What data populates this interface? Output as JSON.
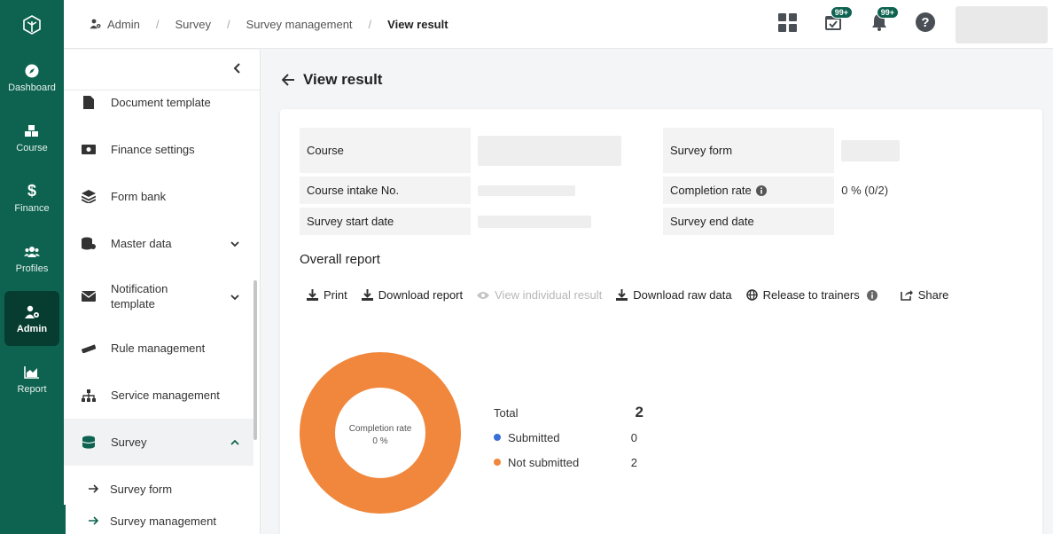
{
  "rail": {
    "items": [
      {
        "label": "Dashboard"
      },
      {
        "label": "Course"
      },
      {
        "label": "Finance"
      },
      {
        "label": "Profiles"
      },
      {
        "label": "Admin"
      },
      {
        "label": "Report"
      }
    ]
  },
  "breadcrumb": [
    "Admin",
    "Survey",
    "Survey management",
    "View result"
  ],
  "topbar": {
    "tasks_badge": "99+",
    "notifications_badge": "99+"
  },
  "sidebar": {
    "items": [
      {
        "label": "Document template"
      },
      {
        "label": "Finance settings"
      },
      {
        "label": "Form bank"
      },
      {
        "label": "Master data"
      },
      {
        "label": "Notification template"
      },
      {
        "label": "Rule management"
      },
      {
        "label": "Service management"
      },
      {
        "label": "Survey"
      }
    ],
    "sub_items": [
      {
        "label": "Survey form"
      },
      {
        "label": "Survey management"
      }
    ]
  },
  "page": {
    "title": "View result"
  },
  "info": {
    "course_label": "Course",
    "intake_label": "Course intake No.",
    "start_label": "Survey start date",
    "form_label": "Survey form",
    "completion_label": "Completion rate",
    "completion_value": "0 % (0/2)",
    "end_label": "Survey end date"
  },
  "report": {
    "heading": "Overall report",
    "actions": {
      "print": "Print",
      "download_report": "Download report",
      "view_individual": "View individual result",
      "download_raw": "Download raw data",
      "release": "Release to trainers",
      "share": "Share"
    }
  },
  "chart_data": {
    "type": "pie",
    "title": "",
    "center_label": "Completion rate",
    "center_value": "0 %",
    "total_label": "Total",
    "total": 2,
    "series": [
      {
        "name": "Submitted",
        "value": 0,
        "color": "#3a6fd8"
      },
      {
        "name": "Not submitted",
        "value": 2,
        "color": "#f0873c"
      }
    ]
  },
  "colors": {
    "brand": "#0e6350",
    "donut_not_submitted": "#f0873c",
    "donut_submitted": "#3a6fd8"
  }
}
